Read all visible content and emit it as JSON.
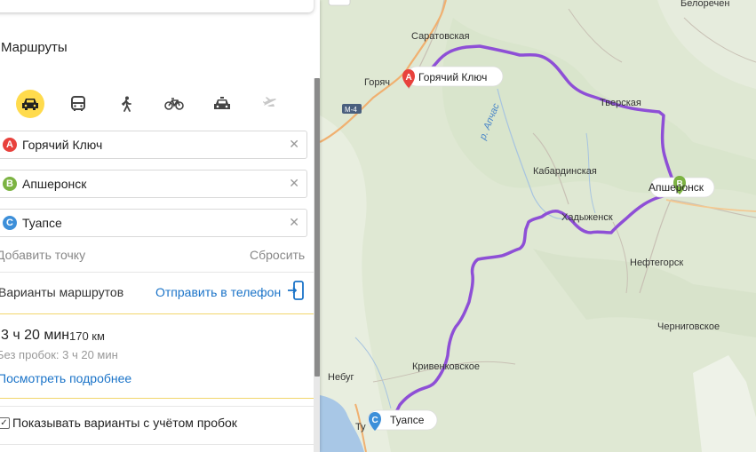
{
  "panel": {
    "title": "Маршруты",
    "transport_modes": [
      "car-icon",
      "bus-icon",
      "walk-icon",
      "bike-icon",
      "taxi-icon",
      "plane-icon"
    ],
    "waypoints": [
      {
        "letter": "A",
        "value": "Горячий Ключ",
        "color": "#e8413c"
      },
      {
        "letter": "B",
        "value": "Апшеронск",
        "color": "#7cb342"
      },
      {
        "letter": "C",
        "value": "Туапсе",
        "color": "#3d8fd9"
      }
    ],
    "add_point": "Добавить точку",
    "reset": "Сбросить",
    "options_title": "Варианты маршрутов",
    "send_to_phone": "Отправить в телефон",
    "route": {
      "time": "3 ч 20 мин",
      "distance": "170 км",
      "no_traffic": "Без пробок: 3 ч 20 мин",
      "details": "Посмотреть подробнее"
    },
    "traffic_checkbox": "Показывать варианты с учётом пробок"
  },
  "map": {
    "route_color": "#8e4fd6",
    "towns": {
      "velorech": "Белоречен",
      "saratovskaya": "Саратовская",
      "goryach_part": "Горяч",
      "tverskaya": "Тверская",
      "kabardinskaya": "Кабардинская",
      "khadyzhensk": "Хадыженск",
      "neftegorsk": "Нефтегорск",
      "chernigovskoe": "Черниговское",
      "nebug": "Небуг",
      "krivenkovskoe": "Кривенковское",
      "tu_part": "Ту"
    },
    "road_shield": "М-4",
    "river": "р. Апчас",
    "pins": [
      {
        "letter": "A",
        "label": "Горячий Ключ"
      },
      {
        "letter": "B",
        "label": "Апшеронск"
      },
      {
        "letter": "C",
        "label": "Туапсе"
      }
    ]
  }
}
